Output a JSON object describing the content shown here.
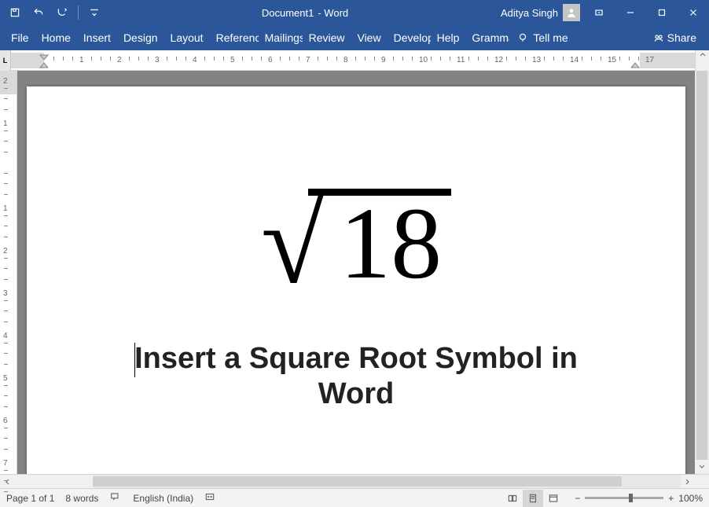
{
  "titlebar": {
    "doc_name": "Document1",
    "app_suffix": " - Word",
    "user_name": "Aditya Singh"
  },
  "ribbon": {
    "tabs": [
      "File",
      "Home",
      "Insert",
      "Design",
      "Layout",
      "References",
      "Mailings",
      "Review",
      "View",
      "Developer",
      "Help",
      "Grammarly"
    ],
    "tellme_label": "Tell me",
    "share_label": "Share"
  },
  "ruler": {
    "h_numbers": [
      "1",
      "2",
      "3",
      "4",
      "5",
      "6",
      "7",
      "8",
      "9",
      "10",
      "11",
      "12",
      "13",
      "14",
      "15",
      "17"
    ],
    "v_numbers": [
      "2",
      "1",
      "1",
      "2",
      "3",
      "4",
      "5",
      "6",
      "7"
    ]
  },
  "document": {
    "equation_value": "18",
    "caption": "Insert a Square Root Symbol in Word"
  },
  "statusbar": {
    "page_info": "Page 1 of 1",
    "word_count": "8 words",
    "language": "English (India)",
    "zoom_label": "100%"
  }
}
